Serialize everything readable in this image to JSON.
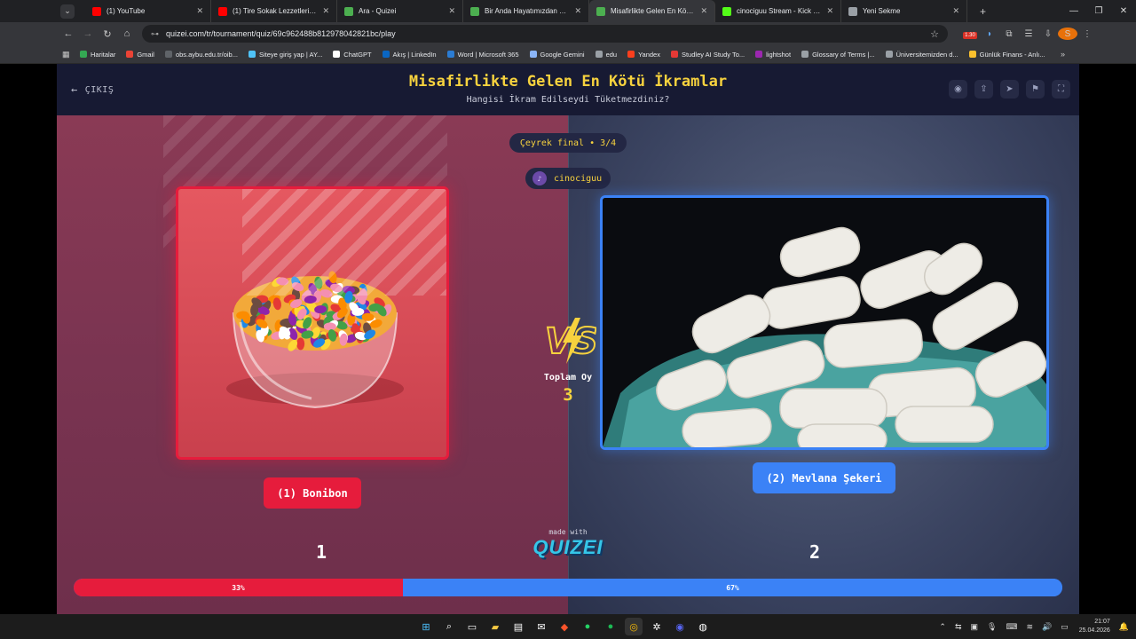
{
  "browser": {
    "tabs": [
      {
        "title": "(1) YouTube",
        "color": "#ff0000",
        "active": false
      },
      {
        "title": "(1) Tire Sokak Lezzetleri | Vlog",
        "color": "#ff0000",
        "active": false
      },
      {
        "title": "Ara - Quizei",
        "color": "#4caf50",
        "active": false
      },
      {
        "title": "Bir Anda Hayatımızdan Çıkan",
        "color": "#4caf50",
        "active": false
      },
      {
        "title": "Misafirlikte Gelen En Kötü İkram",
        "color": "#4caf50",
        "active": true
      },
      {
        "title": "cinociguu Stream - Kick Dashb",
        "color": "#53fc18",
        "active": false
      },
      {
        "title": "Yeni Sekme",
        "color": "#9aa0a6",
        "active": false
      }
    ],
    "url": "quizei.com/tr/tournament/quiz/69c962488b8129780428​21bc/play",
    "ext_badge": "1.30",
    "profile_initial": "S",
    "bookmarks": [
      {
        "label": "Haritalar",
        "color": "#34a853"
      },
      {
        "label": "Gmail",
        "color": "#ea4335"
      },
      {
        "label": "obs.aybu.edu.tr/oib...",
        "color": "#5f6368"
      },
      {
        "label": "Siteye giriş yap | AY...",
        "color": "#4fc3f7"
      },
      {
        "label": "ChatGPT",
        "color": "#ffffff"
      },
      {
        "label": "Akış | LinkedIn",
        "color": "#0a66c2"
      },
      {
        "label": "Word | Microsoft 365",
        "color": "#2b7cd3"
      },
      {
        "label": "Google Gemini",
        "color": "#8ab4f8"
      },
      {
        "label": "edu",
        "color": "#9aa0a6"
      },
      {
        "label": "Yandex",
        "color": "#fc3f1d"
      },
      {
        "label": "Studley AI Study To...",
        "color": "#e53935"
      },
      {
        "label": "lightshot",
        "color": "#9c27b0"
      },
      {
        "label": "Glossary of Terms |...",
        "color": "#9aa0a6"
      },
      {
        "label": "Üniversitemizden d...",
        "color": "#9aa0a6"
      },
      {
        "label": "Günlük Finans - Anlı...",
        "color": "#fbc02d"
      }
    ]
  },
  "header": {
    "exit_label": "ÇIKIŞ",
    "title": "Misafirlikte Gelen En Kötü İkramlar",
    "subtitle": "Hangisi İkram Edilseydi Tüketmezdiniz?",
    "icons": [
      "eye-icon",
      "share-icon",
      "send-icon",
      "flag-icon",
      "fullscreen-icon"
    ]
  },
  "match": {
    "round": "Çeyrek final • 3/4",
    "username": "cinociguu",
    "left": {
      "label": "(1) Bonibon",
      "votes": "1",
      "percent_label": "33%",
      "percent": 33.3
    },
    "right": {
      "label": "(2) Mevlana Şekeri",
      "votes": "2",
      "percent_label": "67%",
      "percent": 66.7
    },
    "total_label": "Toplam Oy",
    "total_value": "3",
    "made_with": "made with",
    "brand": "QUIZEI"
  },
  "taskbar": {
    "time": "21:07",
    "date": "25.04.2026"
  },
  "colors": {
    "accent_yellow": "#f7d23e",
    "left_red": "#e61c3c",
    "right_blue": "#3b82f6"
  }
}
